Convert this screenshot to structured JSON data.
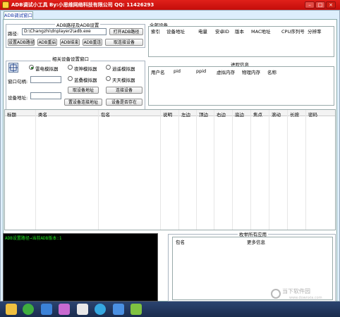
{
  "window": {
    "title": "ADB调试小工具  By:小思维网络科技有限公司  QQ:  11426293",
    "minimize": "–",
    "maximize": "□",
    "close": "×"
  },
  "tab": "ADB调试窗口",
  "adb_path_group": {
    "title": "ADB路径及ADB设置",
    "path_label": "路径:",
    "path_value": "D:\\Changzhi\\dnplayer2\\adb.exe",
    "open_button": "打开ADB路径",
    "buttons": [
      "设置ADB路径",
      "ADB重启",
      "ADB结束",
      "ADB重连",
      "取连接设备"
    ]
  },
  "all_devices": {
    "title": "全部设备",
    "columns": [
      "索引",
      "设备地址",
      "电量",
      "安卓ID",
      "版本",
      "MAC地址",
      "CPU序列号",
      "分辨率"
    ]
  },
  "related_settings": {
    "title": "相关设备设置窗口",
    "radios": [
      {
        "label": "雷电模拟器",
        "checked": true
      },
      {
        "label": "夜神模拟器",
        "checked": false
      },
      {
        "label": "逍遥模拟器",
        "checked": false
      },
      {
        "label": "蓝叠模拟器",
        "checked": false
      },
      {
        "label": "天天模拟器",
        "checked": false
      }
    ],
    "window_handle_label": "窗口句柄:",
    "device_address_label": "设备地址:",
    "buttons": [
      "取设备地址",
      "连接设备",
      "置设备连接地址",
      "设备是否存在"
    ]
  },
  "process_info": {
    "title": "进程信息",
    "columns": [
      "用户名",
      "pid",
      "ppid",
      "虚拟内存",
      "物理内存",
      "名称"
    ]
  },
  "main_table": {
    "columns": [
      "标题",
      "类名",
      "包名",
      "说明",
      "左边",
      "顶边",
      "右边",
      "底边",
      "焦点",
      "滚动",
      "长按",
      "密码"
    ]
  },
  "console": {
    "text": "ADB设置路径→当前ADB版本:1"
  },
  "apps": {
    "title": "枚举所有应用",
    "columns": [
      "包名",
      "更多信息"
    ]
  },
  "watermark": {
    "text": "当下软件园",
    "sub": "www.downxia.com"
  },
  "taskbar_icons": [
    "folder-icon",
    "360-icon",
    "browser-icon",
    "paint-icon",
    "cursor-icon",
    "chrome-icon",
    "calc-icon",
    "android-icon"
  ]
}
